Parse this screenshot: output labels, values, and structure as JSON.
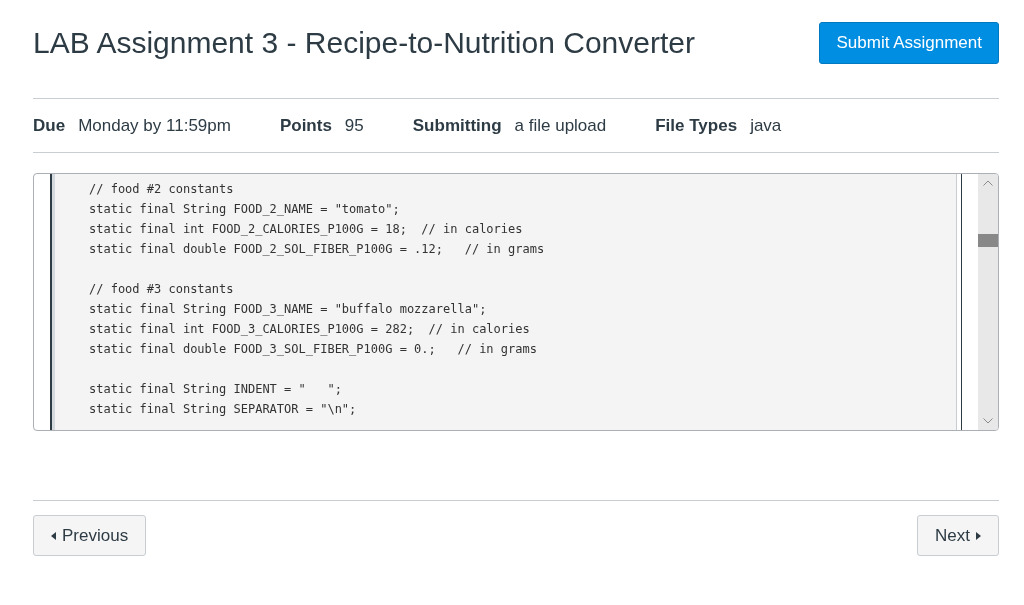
{
  "header": {
    "title": "LAB Assignment 3 - Recipe-to-Nutrition Converter",
    "submit_button": "Submit Assignment"
  },
  "details": [
    {
      "label": "Due",
      "value": "Monday by 11:59pm"
    },
    {
      "label": "Points",
      "value": "95"
    },
    {
      "label": "Submitting",
      "value": "a file upload"
    },
    {
      "label": "File Types",
      "value": "java"
    }
  ],
  "code_viewer": {
    "blocks": [
      [
        "// food #2 constants",
        "static final String FOOD_2_NAME = \"tomato\";",
        "static final int FOOD_2_CALORIES_P100G = 18;  // in calories",
        "static final double FOOD_2_SOL_FIBER_P100G = .12;   // in grams"
      ],
      [
        "// food #3 constants",
        "static final String FOOD_3_NAME = \"buffalo mozzarella\";",
        "static final int FOOD_3_CALORIES_P100G = 282;  // in calories",
        "static final double FOOD_3_SOL_FIBER_P100G = 0.;   // in grams"
      ],
      [
        "static final String INDENT = \"   \";",
        "static final String SEPARATOR = \"\\n\";"
      ]
    ]
  },
  "pagination": {
    "previous": "Previous",
    "next": "Next"
  }
}
